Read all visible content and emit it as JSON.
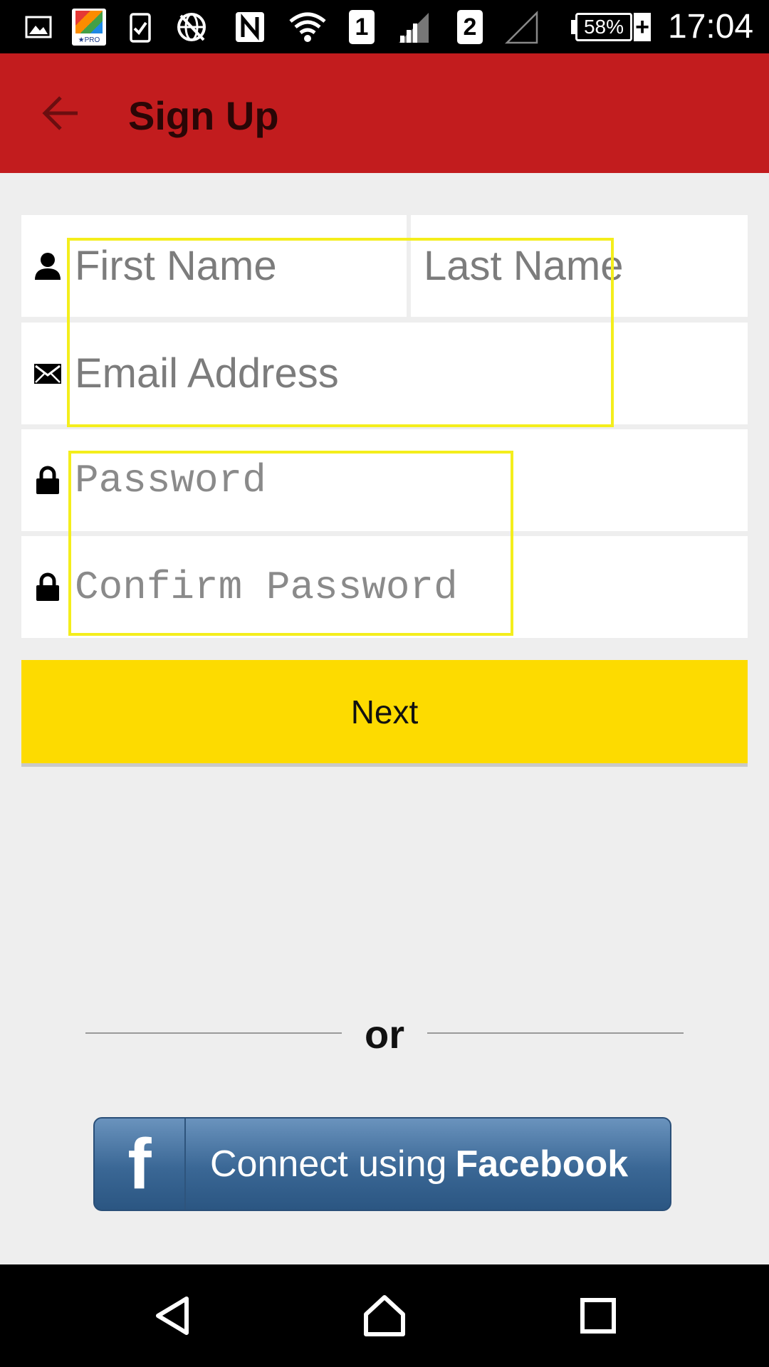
{
  "status_bar": {
    "time": "17:04",
    "battery": "58%",
    "sim1": "1",
    "sim2": "2",
    "icons": [
      "image-icon",
      "avg-pro-icon",
      "clipboard-check-icon",
      "no-globe-icon",
      "nfc-icon",
      "wifi-icon",
      "signal-icon",
      "signal-empty-icon",
      "battery-icon"
    ],
    "avg_badge": "★PRO"
  },
  "app_bar": {
    "title": "Sign Up",
    "back_icon": "arrow-left-icon",
    "color": "#c21c1e"
  },
  "form": {
    "first_name_placeholder": "First Name",
    "last_name_placeholder": "Last Name",
    "email_placeholder": "Email Address",
    "password_placeholder": "Password",
    "confirm_password_placeholder": "Confirm Password",
    "icons": {
      "name": "person-icon",
      "email": "envelope-icon",
      "password": "lock-icon",
      "confirm_password": "lock-icon"
    }
  },
  "next_button": {
    "label": "Next",
    "color": "#fddb00"
  },
  "divider": {
    "label": "or"
  },
  "facebook_button": {
    "icon_letter": "f",
    "label_prefix": "Connect using",
    "label_brand": "Facebook"
  },
  "nav_bar": {
    "icons": [
      "back-triangle-icon",
      "home-icon",
      "recents-square-icon"
    ]
  }
}
